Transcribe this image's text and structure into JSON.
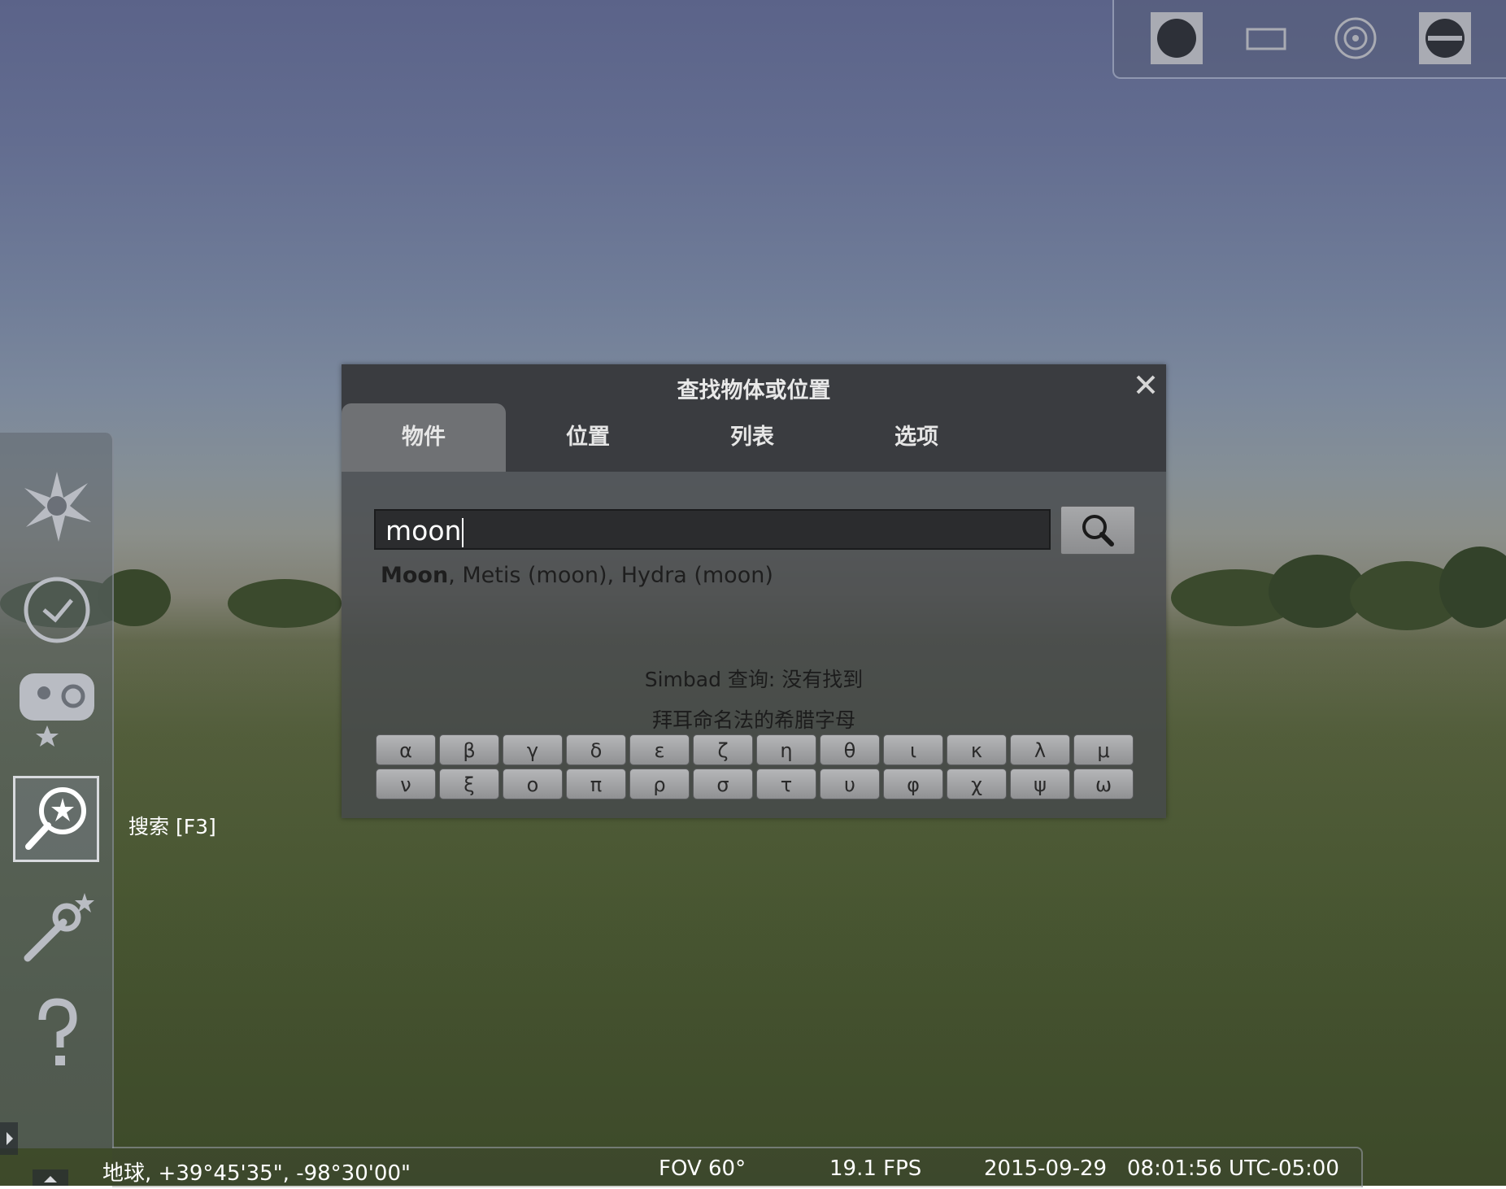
{
  "dialog": {
    "title": "查找物体或位置",
    "tabs": [
      {
        "label": "物件",
        "active": true
      },
      {
        "label": "位置",
        "active": false
      },
      {
        "label": "列表",
        "active": false
      },
      {
        "label": "选项",
        "active": false
      }
    ],
    "search": {
      "value": "moon"
    },
    "results": {
      "first_bold": "Moon",
      "rest": ", Metis (moon), Hydra (moon)"
    },
    "simbad_status": "Simbad 查询: 没有找到",
    "greek_label": "拜耳命名法的希腊字母",
    "greek_row1": [
      "α",
      "β",
      "γ",
      "δ",
      "ε",
      "ζ",
      "η",
      "θ",
      "ι",
      "κ",
      "λ",
      "μ"
    ],
    "greek_row2": [
      "ν",
      "ξ",
      "ο",
      "π",
      "ρ",
      "σ",
      "τ",
      "υ",
      "φ",
      "χ",
      "ψ",
      "ω"
    ]
  },
  "left_bar": {
    "items": [
      {
        "icon": "sky-and-viewing-options-icon"
      },
      {
        "icon": "date-time-icon"
      },
      {
        "icon": "sky-culture-icon"
      },
      {
        "icon": "search-window-icon"
      },
      {
        "icon": "configuration-icon"
      },
      {
        "icon": "help-icon"
      }
    ],
    "tooltip": "搜索  [F3]"
  },
  "top_panel": {
    "items": [
      {
        "icon": "circle-mask-icon"
      },
      {
        "icon": "rectangle-mask-icon"
      },
      {
        "icon": "target-icon"
      },
      {
        "icon": "toggle-panel-icon"
      }
    ]
  },
  "bottom_bar": {
    "location": "地球, +39°45'35\", -98°30'00\"",
    "fov": "FOV 60°",
    "fps": "19.1 FPS",
    "date": "2015-09-29",
    "time": "08:01:56 UTC-05:00"
  },
  "colors": {
    "sky_top": "#5b6389",
    "horizon": "#8b8f8a",
    "grass": "#4e5c36",
    "dialog_bg": "#46484c",
    "tab_active": "#6f7174"
  }
}
